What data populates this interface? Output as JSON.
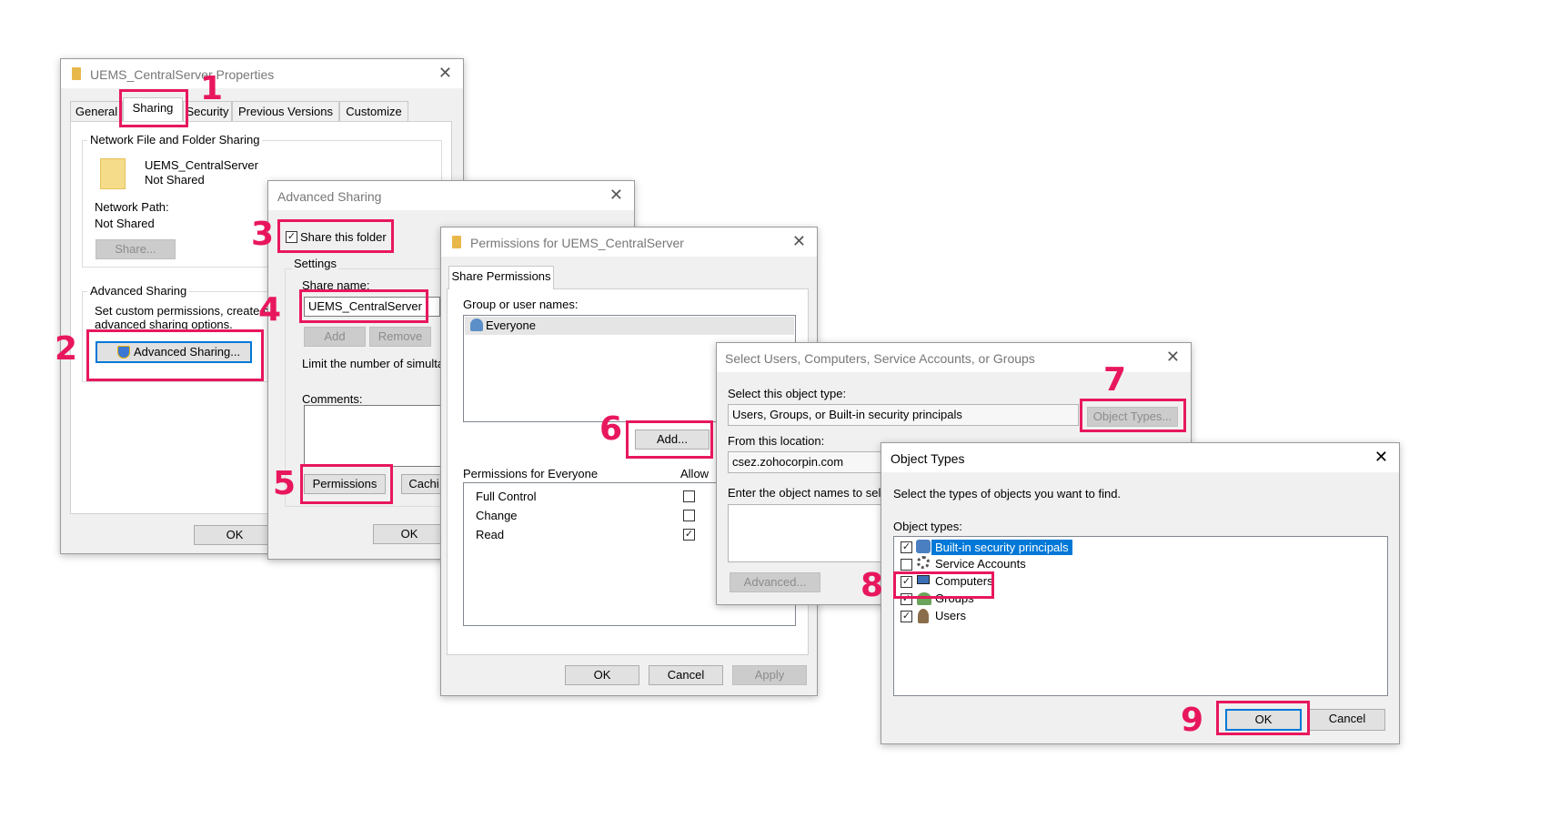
{
  "properties_window": {
    "title": "UEMS_CentralServer Properties",
    "tabs": [
      "General",
      "Sharing",
      "Security",
      "Previous Versions",
      "Customize"
    ],
    "network_group_label": "Network File and Folder Sharing",
    "folder_name": "UEMS_CentralServer",
    "folder_status": "Not Shared",
    "network_path_label": "Network Path:",
    "network_path_value": "Not Shared",
    "share_button": "Share...",
    "advanced_group_label": "Advanced Sharing",
    "advanced_desc_1": "Set custom permissions, create m",
    "advanced_desc_2": "advanced sharing options.",
    "advanced_button": "Advanced Sharing...",
    "ok_button": "OK"
  },
  "advanced_window": {
    "title": "Advanced Sharing",
    "share_checkbox": "Share this folder",
    "settings_label": "Settings",
    "share_name_label": "Share name:",
    "share_name_value": "UEMS_CentralServer",
    "add_button": "Add",
    "remove_button": "Remove",
    "limit_label": "Limit the number of simultan",
    "comments_label": "Comments:",
    "permissions_button": "Permissions",
    "caching_button": "Cachi",
    "ok_button": "OK"
  },
  "permissions_window": {
    "title": "Permissions for UEMS_CentralServer",
    "tab": "Share Permissions",
    "group_label": "Group or user names:",
    "users": [
      "Everyone"
    ],
    "add_button": "Add...",
    "perm_header": "Permissions for Everyone",
    "allow_header": "Allow",
    "permissions": [
      {
        "name": "Full Control",
        "allow": false
      },
      {
        "name": "Change",
        "allow": false
      },
      {
        "name": "Read",
        "allow": true
      }
    ],
    "ok_button": "OK",
    "cancel_button": "Cancel",
    "apply_button": "Apply"
  },
  "select_window": {
    "title": "Select Users, Computers, Service Accounts, or Groups",
    "object_type_label": "Select this object type:",
    "object_type_value": "Users, Groups, or Built-in security principals",
    "object_types_button": "Object Types...",
    "location_label": "From this location:",
    "location_value": "csez.zohocorpin.com",
    "enter_label": "Enter the object names to selec",
    "advanced_button": "Advanced..."
  },
  "object_types_window": {
    "title": "Object Types",
    "desc": "Select the types of objects you want to find.",
    "list_label": "Object types:",
    "items": [
      {
        "name": "Built-in security principals",
        "checked": true,
        "selected": true
      },
      {
        "name": "Service Accounts",
        "checked": false,
        "selected": false
      },
      {
        "name": "Computers",
        "checked": true,
        "selected": false
      },
      {
        "name": "Groups",
        "checked": true,
        "selected": false
      },
      {
        "name": "Users",
        "checked": true,
        "selected": false
      }
    ],
    "ok_button": "OK",
    "cancel_button": "Cancel"
  },
  "steps": [
    "1",
    "2",
    "3",
    "4",
    "5",
    "6",
    "7",
    "8",
    "9"
  ],
  "colors": {
    "callout": "#e8175d",
    "selection": "#0078d7"
  },
  "glyphs": {
    "close": "✕",
    "check": "✓"
  }
}
